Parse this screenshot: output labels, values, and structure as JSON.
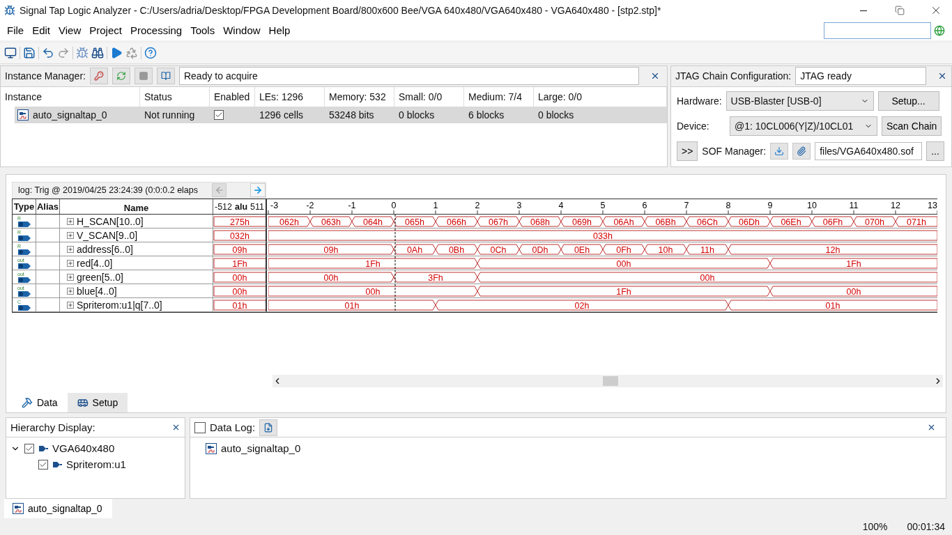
{
  "window": {
    "title": "Signal Tap Logic Analyzer - C:/Users/adria/Desktop/FPGA Development Board/800x600 Bee/VGA 640x480/VGA640x480 - VGA640x480 - [stp2.stp]*"
  },
  "menu": [
    "File",
    "Edit",
    "View",
    "Project",
    "Processing",
    "Tools",
    "Window",
    "Help"
  ],
  "instance_manager": {
    "label": "Instance Manager:",
    "status": "Ready to acquire",
    "columns": [
      "Instance",
      "Status",
      "Enabled",
      "LEs: 1296",
      "Memory: 532",
      "Small: 0/0",
      "Medium: 7/4",
      "Large: 0/0"
    ],
    "rows": [
      {
        "cells": [
          "auto_signaltap_0",
          "Not running",
          "",
          "1296 cells",
          "53248 bits",
          "0 blocks",
          "6 blocks",
          "0 blocks"
        ],
        "enabled": true,
        "selected": true
      }
    ]
  },
  "jtag": {
    "label": "JTAG Chain Configuration:",
    "status": "JTAG ready",
    "hardware_label": "Hardware:",
    "hardware": "USB-Blaster [USB-0]",
    "setup_button": "Setup...",
    "device_label": "Device:",
    "device": "@1: 10CL006(Y|Z)/10CL01",
    "scan_button": "Scan Chain",
    "expand_button": ">>",
    "sof_label": "SOF Manager:",
    "sof_file": "files/VGA640x480.sof",
    "browse_button": "..."
  },
  "waveform": {
    "log": "log: Trig @ 2019/04/25 23:24:39 (0:0:0.2 elaps",
    "columns": [
      "Type",
      "Alias",
      "Name"
    ],
    "pre_range": [
      "-512",
      "alu",
      "511"
    ],
    "ticks": [
      {
        "label": "-3"
      },
      {
        "label": "-2"
      },
      {
        "label": "-1"
      },
      {
        "label": "0",
        "trigger": true
      },
      {
        "label": "1"
      },
      {
        "label": "2"
      },
      {
        "label": "3"
      },
      {
        "label": "4"
      },
      {
        "label": "5"
      },
      {
        "label": "6"
      },
      {
        "label": "7"
      },
      {
        "label": "8"
      },
      {
        "label": "9"
      },
      {
        "label": "10"
      },
      {
        "label": "11"
      },
      {
        "label": "12"
      },
      {
        "label": "13"
      }
    ],
    "signals": [
      {
        "type": "R",
        "name": "H_SCAN[10..0]",
        "pre_value": "275h",
        "intervals": [
          {
            "kind": "change",
            "value": "062h"
          },
          {
            "kind": "change",
            "value": "063h"
          },
          {
            "kind": "change",
            "value": "064h"
          },
          {
            "kind": "change",
            "value": "065h"
          },
          {
            "kind": "change",
            "value": "066h"
          },
          {
            "kind": "change",
            "value": "067h"
          },
          {
            "kind": "change",
            "value": "068h"
          },
          {
            "kind": "change",
            "value": "069h"
          },
          {
            "kind": "change",
            "value": "06Ah"
          },
          {
            "kind": "change",
            "value": "06Bh"
          },
          {
            "kind": "change",
            "value": "06Ch"
          },
          {
            "kind": "change",
            "value": "06Dh"
          },
          {
            "kind": "change",
            "value": "06Eh"
          },
          {
            "kind": "change",
            "value": "06Fh"
          },
          {
            "kind": "change",
            "value": "070h"
          },
          {
            "kind": "change",
            "value": "071h"
          }
        ]
      },
      {
        "type": "R",
        "name": "V_SCAN[9..0]",
        "pre_value": "032h",
        "intervals": [
          {
            "kind": "change",
            "value": "033h"
          },
          {
            "kind": "hold"
          },
          {
            "kind": "hold"
          },
          {
            "kind": "hold"
          },
          {
            "kind": "hold"
          },
          {
            "kind": "hold"
          },
          {
            "kind": "hold"
          },
          {
            "kind": "hold"
          },
          {
            "kind": "hold"
          },
          {
            "kind": "hold"
          },
          {
            "kind": "hold"
          },
          {
            "kind": "hold"
          },
          {
            "kind": "hold"
          },
          {
            "kind": "hold"
          },
          {
            "kind": "hold"
          },
          {
            "kind": "hold"
          }
        ]
      },
      {
        "type": "R",
        "name": "address[6..0]",
        "pre_value": "09h",
        "intervals": [
          {
            "kind": "change",
            "value": "09h"
          },
          {
            "kind": "hold"
          },
          {
            "kind": "hold"
          },
          {
            "kind": "change",
            "value": "0Ah"
          },
          {
            "kind": "change",
            "value": "0Bh"
          },
          {
            "kind": "change",
            "value": "0Ch"
          },
          {
            "kind": "change",
            "value": "0Dh"
          },
          {
            "kind": "change",
            "value": "0Eh"
          },
          {
            "kind": "change",
            "value": "0Fh"
          },
          {
            "kind": "change",
            "value": "10h"
          },
          {
            "kind": "change",
            "value": "11h"
          },
          {
            "kind": "change",
            "value": "12h"
          },
          {
            "kind": "hold"
          },
          {
            "kind": "hold"
          },
          {
            "kind": "hold"
          },
          {
            "kind": "hold"
          }
        ]
      },
      {
        "type": "out",
        "name": "red[4..0]",
        "pre_value": "1Fh",
        "intervals": [
          {
            "kind": "change",
            "value": "1Fh"
          },
          {
            "kind": "hold"
          },
          {
            "kind": "hold"
          },
          {
            "kind": "hold"
          },
          {
            "kind": "hold"
          },
          {
            "kind": "change",
            "value": "00h"
          },
          {
            "kind": "hold"
          },
          {
            "kind": "hold"
          },
          {
            "kind": "hold"
          },
          {
            "kind": "hold"
          },
          {
            "kind": "hold"
          },
          {
            "kind": "hold"
          },
          {
            "kind": "change",
            "value": "1Fh"
          },
          {
            "kind": "hold"
          },
          {
            "kind": "hold"
          },
          {
            "kind": "hold"
          }
        ]
      },
      {
        "type": "out",
        "name": "green[5..0]",
        "pre_value": "00h",
        "intervals": [
          {
            "kind": "change",
            "value": "00h"
          },
          {
            "kind": "hold"
          },
          {
            "kind": "hold"
          },
          {
            "kind": "change",
            "value": "3Fh"
          },
          {
            "kind": "hold"
          },
          {
            "kind": "change",
            "value": "00h"
          },
          {
            "kind": "hold"
          },
          {
            "kind": "hold"
          },
          {
            "kind": "hold"
          },
          {
            "kind": "hold"
          },
          {
            "kind": "hold"
          },
          {
            "kind": "hold"
          },
          {
            "kind": "hold"
          },
          {
            "kind": "hold"
          },
          {
            "kind": "hold"
          },
          {
            "kind": "hold"
          }
        ]
      },
      {
        "type": "out",
        "name": "blue[4..0]",
        "pre_value": "00h",
        "intervals": [
          {
            "kind": "change",
            "value": "00h"
          },
          {
            "kind": "hold"
          },
          {
            "kind": "hold"
          },
          {
            "kind": "hold"
          },
          {
            "kind": "hold"
          },
          {
            "kind": "change",
            "value": "1Fh"
          },
          {
            "kind": "hold"
          },
          {
            "kind": "hold"
          },
          {
            "kind": "hold"
          },
          {
            "kind": "hold"
          },
          {
            "kind": "hold"
          },
          {
            "kind": "hold"
          },
          {
            "kind": "change",
            "value": "00h"
          },
          {
            "kind": "hold"
          },
          {
            "kind": "hold"
          },
          {
            "kind": "hold"
          }
        ]
      },
      {
        "type": "C",
        "name": "Spriterom:u1|q[7..0]",
        "pre_value": "01h",
        "intervals": [
          {
            "kind": "change",
            "value": "01h"
          },
          {
            "kind": "hold"
          },
          {
            "kind": "hold"
          },
          {
            "kind": "hold"
          },
          {
            "kind": "change",
            "value": "02h"
          },
          {
            "kind": "hold"
          },
          {
            "kind": "hold"
          },
          {
            "kind": "hold"
          },
          {
            "kind": "hold"
          },
          {
            "kind": "hold"
          },
          {
            "kind": "hold"
          },
          {
            "kind": "change",
            "value": "01h"
          },
          {
            "kind": "hold"
          },
          {
            "kind": "hold"
          },
          {
            "kind": "hold"
          },
          {
            "kind": "hold"
          }
        ]
      }
    ]
  },
  "view_tabs": [
    {
      "label": "Data",
      "selected": true
    },
    {
      "label": "Setup",
      "selected": false
    }
  ],
  "hierarchy": {
    "title": "Hierarchy Display:",
    "tree": [
      {
        "label": "VGA640x480",
        "checked": true,
        "expanded": true,
        "children": [
          {
            "label": "Spriterom:u1",
            "checked": true
          }
        ]
      }
    ]
  },
  "data_log": {
    "label": "Data Log:",
    "checked": false,
    "items": [
      "auto_signaltap_0"
    ]
  },
  "instance_tabs": [
    {
      "label": "auto_signaltap_0",
      "selected": true
    }
  ],
  "status_bar": {
    "zoom": "100%",
    "time": "00:01:34"
  }
}
